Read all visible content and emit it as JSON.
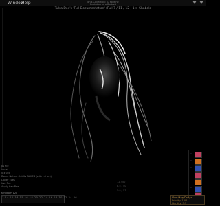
{
  "menu": {
    "items": [
      "",
      "Window",
      "Help"
    ]
  },
  "title": {
    "line1": "on's Collection: © Fontine",
    "line2": "Evolution of a Portrait",
    "info": "Tulsa Doe's 'Full Documentation' (Full 7 / 11 / 12 ) 1 > Shabala"
  },
  "left_panel": {
    "lines": [
      "ps file",
      "Vistal",
      "0.4 0.5",
      "Dome Nature Outfits BAKED (with mi pm)",
      "Lower Eyes",
      "Use Fax",
      "Apply hap Pins"
    ],
    "timeline_label": "Kingdom 120",
    "ticks": [
      "1.14",
      "12",
      "14",
      "15",
      "16",
      "18",
      "20",
      "22",
      "24",
      "26",
      "28",
      "30",
      "32",
      "34",
      "36"
    ]
  },
  "readouts": [
    "12 / 50",
    "8.5 / 40",
    "5.0 / 37"
  ],
  "right_panel": {
    "buttons": [
      "—",
      "—",
      "—",
      "—",
      "—",
      "—",
      "—"
    ]
  },
  "status": {
    "line1": "View Map/DoB/ra",
    "line2": "Priority: 1.04",
    "line3": "Identity: 9.9"
  },
  "colors": {
    "accent": "#d6a24a",
    "swatch_pink": "#c04060",
    "swatch_orange": "#d07020",
    "swatch_blue": "#3050b0"
  }
}
